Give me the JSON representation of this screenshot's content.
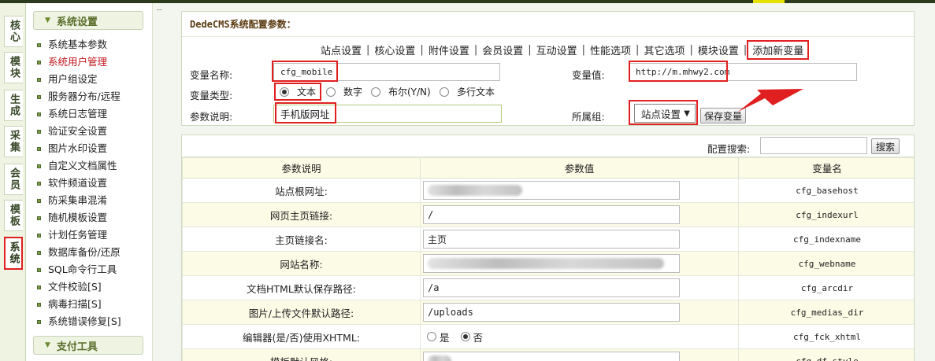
{
  "sidebar": {
    "tabs": [
      "核心",
      "模块",
      "生成",
      "采集",
      "会员",
      "模板",
      "系统"
    ],
    "active_tab": "系统"
  },
  "menu": {
    "section_title": "系统设置",
    "items": [
      "系统基本参数",
      "系统用户管理",
      "用户组设定",
      "服务器分布/远程",
      "系统日志管理",
      "验证安全设置",
      "图片水印设置",
      "自定义文档属性",
      "软件频道设置",
      "防采集串混淆",
      "随机模板设置",
      "计划任务管理",
      "数据库备份/还原",
      "SQL命令行工具",
      "文件校验[S]",
      "病毒扫描[S]",
      "系统错误修复[S]"
    ],
    "active_item": "系统用户管理",
    "section2_title": "支付工具"
  },
  "config": {
    "title": "DedeCMS系统配置参数：",
    "tabs": [
      "站点设置",
      "核心设置",
      "附件设置",
      "会员设置",
      "互动设置",
      "性能选项",
      "其它选项",
      "模块设置",
      "添加新变量"
    ],
    "form": {
      "var_name_label": "变量名称:",
      "var_name_value": "cfg_mobile",
      "var_value_label": "变量值:",
      "var_value_value": "http://m.mhwy2.com",
      "var_type_label": "变量类型:",
      "types": [
        "文本",
        "数字",
        "布尔(Y/N)",
        "多行文本"
      ],
      "selected_type": "文本",
      "desc_label": "参数说明:",
      "desc_value": "手机版网址",
      "group_label": "所属组:",
      "group_value": "站点设置",
      "save_button": "保存变量"
    }
  },
  "table": {
    "search_label": "配置搜索:",
    "search_value": "",
    "search_button": "搜索",
    "headers": [
      "参数说明",
      "参数值",
      "变量名"
    ],
    "rows": [
      {
        "desc": "站点根网址:",
        "value": "",
        "name": "cfg_basehost",
        "blurred": true
      },
      {
        "desc": "网页主页链接:",
        "value": "/",
        "name": "cfg_indexurl"
      },
      {
        "desc": "主页链接名:",
        "value": "主页",
        "name": "cfg_indexname"
      },
      {
        "desc": "网站名称:",
        "value": "",
        "name": "cfg_webname",
        "blurred": true
      },
      {
        "desc": "文档HTML默认保存路径:",
        "value": "/a",
        "name": "cfg_arcdir"
      },
      {
        "desc": "图片/上传文件默认路径:",
        "value": "/uploads",
        "name": "cfg_medias_dir"
      },
      {
        "desc": "编辑器(是/否)使用XHTML:",
        "radio": [
          "是",
          "否"
        ],
        "radio_selected": "否",
        "name": "cfg_fck_xhtml"
      },
      {
        "desc": "模板默认风格:",
        "value": "",
        "name": "cfg_df_style",
        "blurred": true
      }
    ]
  },
  "colors": {
    "highlight": "#e02020",
    "menu_active": "#c0161c",
    "header_bg": "#fbfbe6"
  }
}
